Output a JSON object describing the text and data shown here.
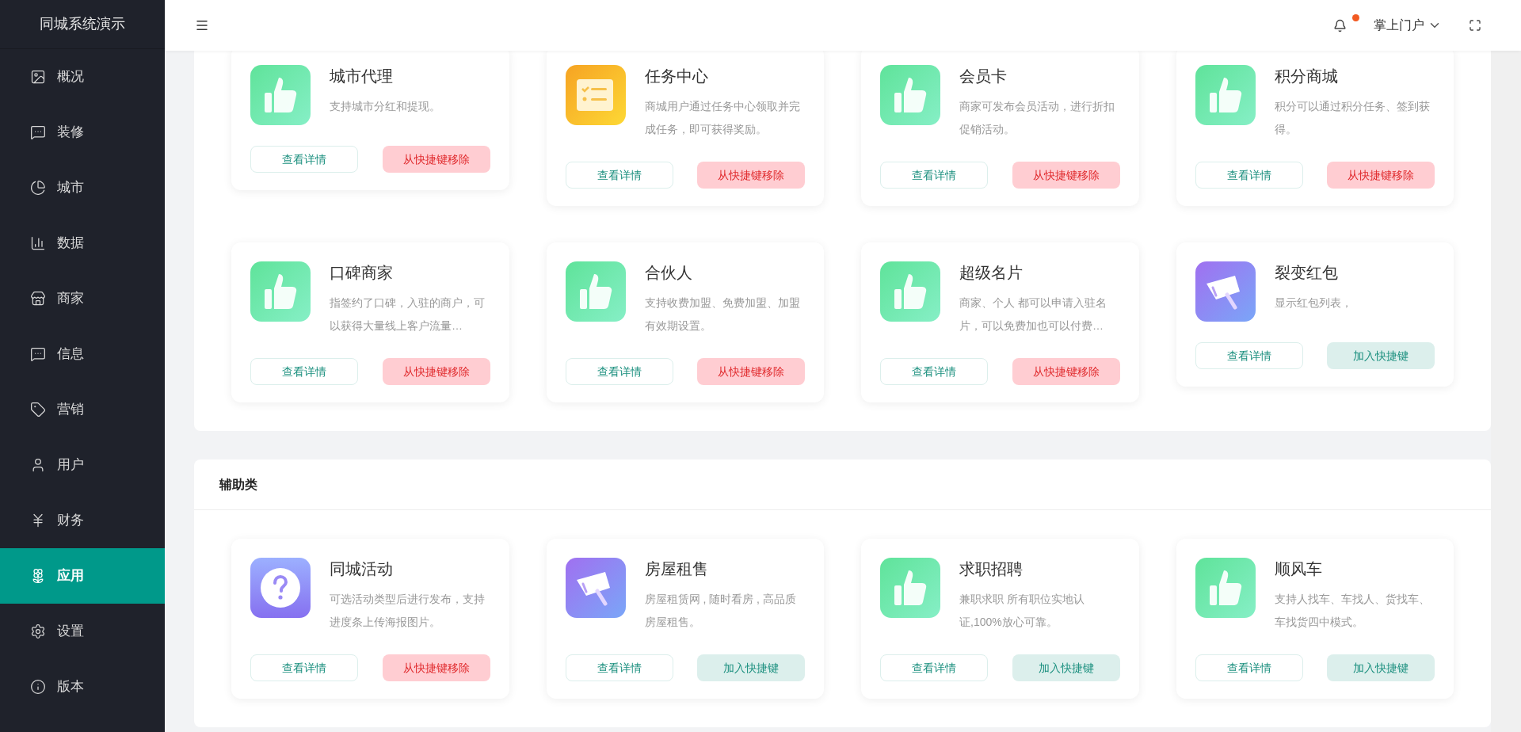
{
  "sidebar": {
    "title": "同城系统演示",
    "items": [
      {
        "label": "概况",
        "selected": false
      },
      {
        "label": "装修",
        "selected": false
      },
      {
        "label": "城市",
        "selected": false
      },
      {
        "label": "数据",
        "selected": false
      },
      {
        "label": "商家",
        "selected": false
      },
      {
        "label": "信息",
        "selected": false
      },
      {
        "label": "营销",
        "selected": false
      },
      {
        "label": "用户",
        "selected": false
      },
      {
        "label": "财务",
        "selected": false
      },
      {
        "label": "应用",
        "selected": true
      },
      {
        "label": "设置",
        "selected": false
      },
      {
        "label": "版本",
        "selected": false
      }
    ]
  },
  "topbar": {
    "notification": true,
    "portal": "掌上门户"
  },
  "sections": [
    {
      "cards": [
        {
          "kind": "thumb",
          "title": "城市代理",
          "description": "支持城市分红和提现。",
          "detail": "查看详情",
          "action": {
            "kind": "remove",
            "label": "从快捷键移除"
          }
        },
        {
          "kind": "task",
          "title": "任务中心",
          "description": "商城用户通过任务中心领取并完成任务，即可获得奖励。",
          "detail": "查看详情",
          "action": {
            "kind": "remove",
            "label": "从快捷键移除"
          }
        },
        {
          "kind": "thumb",
          "title": "会员卡",
          "description": "商家可发布会员活动，进行折扣促销活动。",
          "detail": "查看详情",
          "action": {
            "kind": "remove",
            "label": "从快捷键移除"
          }
        },
        {
          "kind": "thumb",
          "title": "积分商城",
          "description": "积分可以通过积分任务、签到获得。",
          "detail": "查看详情",
          "action": {
            "kind": "remove",
            "label": "从快捷键移除"
          }
        },
        {
          "kind": "thumb",
          "title": "口碑商家",
          "description": "指签约了口碑，入驻的商户，可以获得大量线上客户流量…",
          "detail": "查看详情",
          "action": {
            "kind": "remove",
            "label": "从快捷键移除"
          }
        },
        {
          "kind": "thumb",
          "title": "合伙人",
          "description": "支持收费加盟、免费加盟、加盟有效期设置。",
          "detail": "查看详情",
          "action": {
            "kind": "remove",
            "label": "从快捷键移除"
          }
        },
        {
          "kind": "thumb",
          "title": "超级名片",
          "description": "商家、个人 都可以申请入驻名片，可以免费加也可以付费…",
          "detail": "查看详情",
          "action": {
            "kind": "remove",
            "label": "从快捷键移除"
          }
        },
        {
          "kind": "megaphone",
          "title": "裂变红包",
          "description": "显示红包列表，",
          "detail": "查看详情",
          "action": {
            "kind": "add",
            "label": "加入快捷键"
          }
        }
      ]
    },
    {
      "title": "辅助类",
      "cards": [
        {
          "kind": "question",
          "title": "同城活动",
          "description": "可选活动类型后进行发布，支持进度条上传海报图片。",
          "detail": "查看详情",
          "action": {
            "kind": "remove",
            "label": "从快捷键移除"
          }
        },
        {
          "kind": "megaphone",
          "title": "房屋租售",
          "description": "房屋租赁网 , 随时看房 , 高品质房屋租售。",
          "detail": "查看详情",
          "action": {
            "kind": "add",
            "label": "加入快捷键"
          }
        },
        {
          "kind": "thumb",
          "title": "求职招聘",
          "description": "兼职求职 所有职位实地认证,100%放心可靠。",
          "detail": "查看详情",
          "action": {
            "kind": "add",
            "label": "加入快捷键"
          }
        },
        {
          "kind": "thumb",
          "title": "顺风车",
          "description": "支持人找车、车找人、货找车、车找货四中模式。",
          "detail": "查看详情",
          "action": {
            "kind": "add",
            "label": "加入快捷键"
          }
        }
      ]
    }
  ]
}
